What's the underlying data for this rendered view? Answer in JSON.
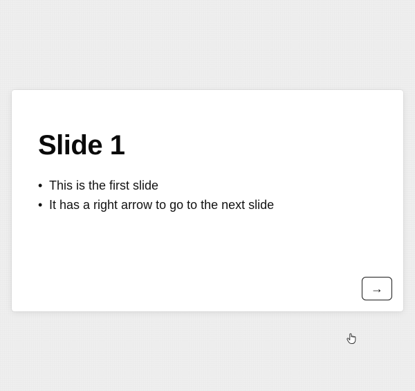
{
  "slide": {
    "title": "Slide 1",
    "bullets": [
      "This is the first slide",
      "It has a right arrow to go to the next slide"
    ],
    "next_arrow_glyph": "→"
  }
}
